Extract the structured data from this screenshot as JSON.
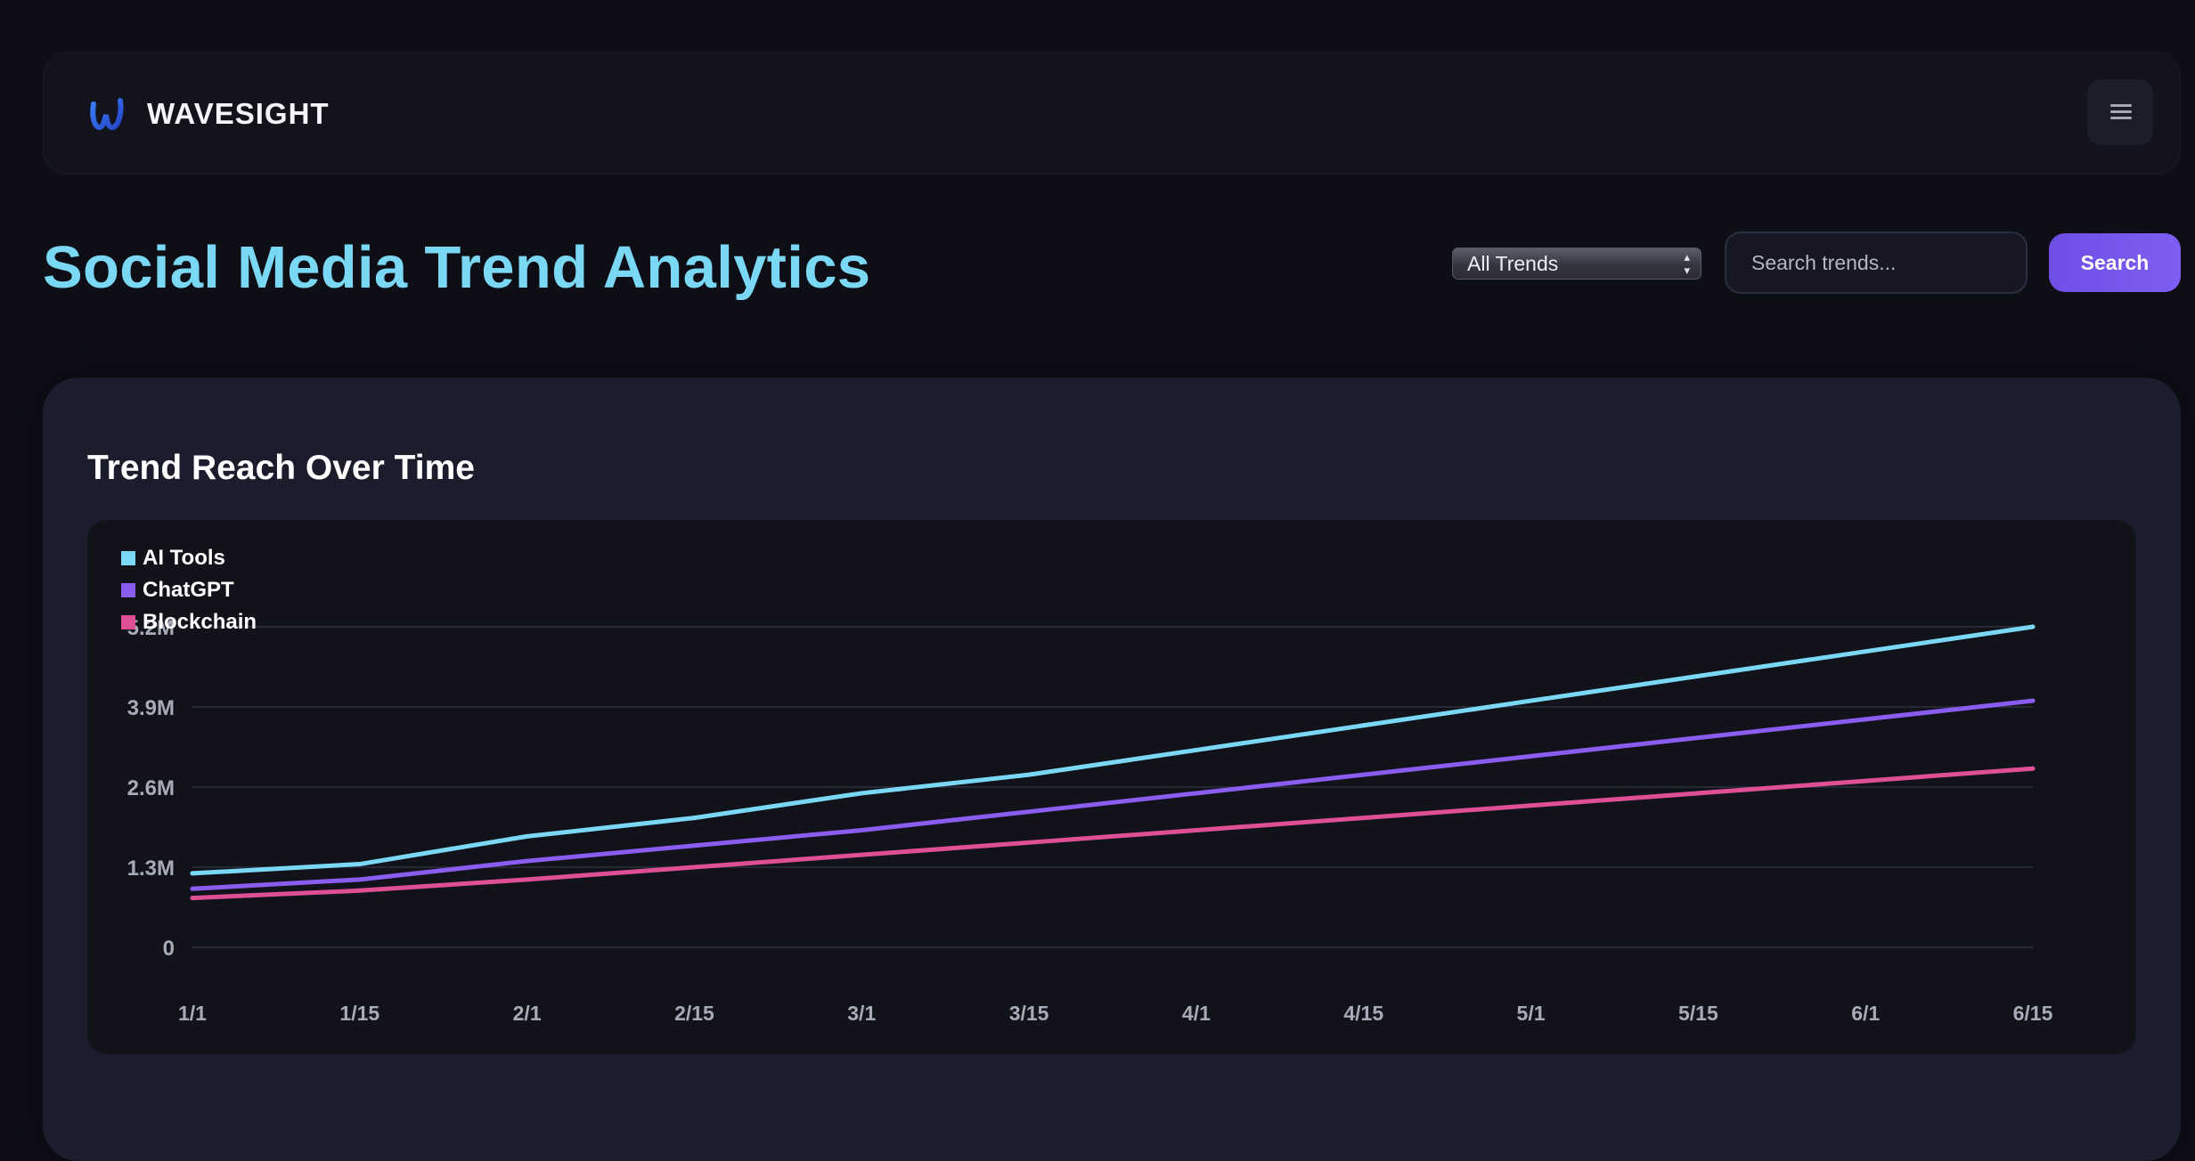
{
  "brand": {
    "name": "WAVESIGHT"
  },
  "header": {
    "title": "Social Media Trend Analytics"
  },
  "controls": {
    "filter_selected": "All Trends",
    "search_placeholder": "Search trends...",
    "search_button": "Search"
  },
  "card": {
    "title": "Trend Reach Over Time"
  },
  "colors": {
    "accent": "#7ad8f4",
    "button": "#7556ec",
    "ai_tools": "#7ad8f4",
    "chatgpt": "#8a5cf0",
    "blockchain": "#df4f96"
  },
  "icons": {
    "logo": "wave-w-logo-icon",
    "menu": "hamburger-menu-icon"
  },
  "chart_data": {
    "type": "line",
    "title": "Trend Reach Over Time",
    "xlabel": "",
    "ylabel": "",
    "legend_position": "top-left",
    "grid": true,
    "x": [
      "1/1",
      "1/15",
      "2/1",
      "2/15",
      "3/1",
      "3/15",
      "4/1",
      "4/15",
      "5/1",
      "5/15",
      "6/1",
      "6/15"
    ],
    "y_ticks": [
      0,
      1.3,
      2.6,
      3.9,
      5.2
    ],
    "y_tick_labels": [
      "0",
      "1.3M",
      "2.6M",
      "3.9M",
      "5.2M"
    ],
    "ylim": [
      0,
      5.2
    ],
    "y_unit": "M",
    "series": [
      {
        "name": "AI Tools",
        "color": "#7ad8f4",
        "values": [
          1.2,
          1.35,
          1.8,
          2.1,
          2.5,
          2.8,
          3.2,
          3.6,
          4.0,
          4.4,
          4.8,
          5.2
        ]
      },
      {
        "name": "ChatGPT",
        "color": "#8a5cf0",
        "values": [
          0.95,
          1.1,
          1.4,
          1.65,
          1.9,
          2.2,
          2.5,
          2.8,
          3.1,
          3.4,
          3.7,
          4.0
        ]
      },
      {
        "name": "Blockchain",
        "color": "#df4f96",
        "values": [
          0.8,
          0.92,
          1.1,
          1.3,
          1.5,
          1.7,
          1.9,
          2.1,
          2.3,
          2.5,
          2.7,
          2.9
        ]
      }
    ]
  }
}
